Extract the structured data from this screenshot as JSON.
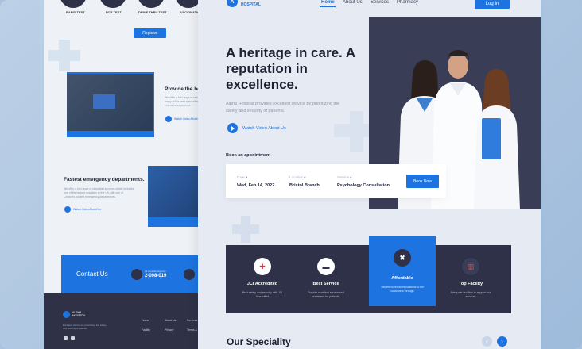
{
  "back_page": {
    "tests": [
      "RAPID TEST",
      "PCR TEST",
      "DRIVE THRU TEST",
      "VACCINATION"
    ],
    "register_label": "Register",
    "section1_title": "Provide the be",
    "section1_desc": "We offer a full range of services and many of the best specialists with extensive experience",
    "section1_watch": "Watch Video About",
    "section2_title": "Fastest emergency departments.",
    "section2_desc": "We offer a full range of specialist services which includes one of the largest hospitals in the UK with one of London's busiest emergency departments.",
    "section2_watch": "Watch Video About Us",
    "contact_title": "Contact Us",
    "contact_small": "24 Hour Emergency",
    "contact_phone": "2-098-019",
    "footer": {
      "brand_line1": "ALPHA",
      "brand_line2": "HOSPITAL",
      "desc": "Excellent service by prioritizing the safety and security of patients.",
      "links_col1": [
        "Home",
        "Facility"
      ],
      "links_col2": [
        "About Us",
        "Privacy"
      ],
      "links_col3": [
        "Services",
        "Terms &"
      ]
    }
  },
  "header": {
    "logo_letter": "A",
    "logo_text": "HOSPITAL",
    "nav": [
      "Home",
      "About Us",
      "Services",
      "Pharmacy"
    ],
    "login_label": "Log In"
  },
  "hero": {
    "title": "A heritage in care. A reputation in excellence.",
    "description": "Alpha Hospital provides excellent service by prioritizing the safety and security of patients.",
    "watch_label": "Watch Video About Us"
  },
  "booking": {
    "label": "Book an appointment",
    "fields": [
      {
        "label": "Date",
        "value": "Wed, Feb 14, 2022"
      },
      {
        "label": "Location",
        "value": "Bristol Branch"
      },
      {
        "label": "Service",
        "value": "Psychology Consultation"
      }
    ],
    "button": "Book Now"
  },
  "features": [
    {
      "title": "JCI Accredited",
      "desc": "Best safety and security with JCI Accredited"
    },
    {
      "title": "Best Service",
      "desc": "Provide excellent service and treatment for patients"
    },
    {
      "title": "Affordable",
      "desc": "Treatment recommendations to the customers through"
    },
    {
      "title": "Top Facility",
      "desc": "Adequate facilities to support our services"
    }
  ],
  "speciality_title": "Our Speciality",
  "colors": {
    "accent": "#1d74e0",
    "dark": "#2e3148"
  }
}
